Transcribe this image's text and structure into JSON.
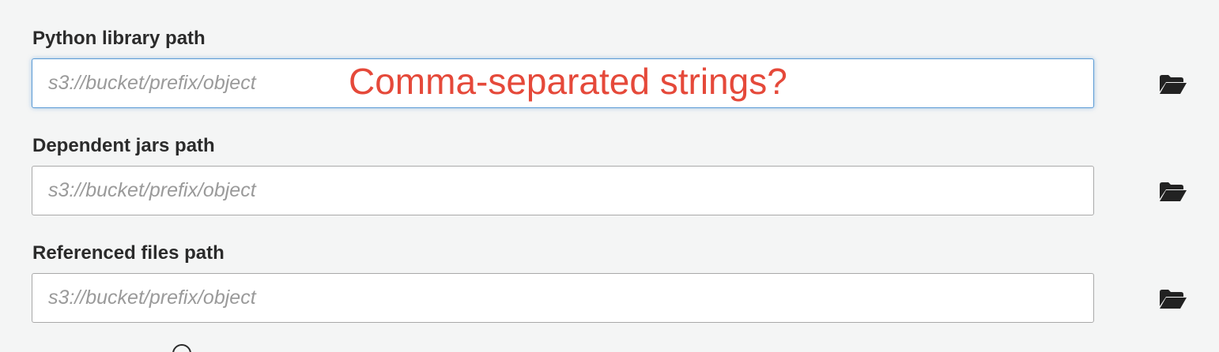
{
  "fields": [
    {
      "label": "Python library path",
      "placeholder": "s3://bucket/prefix/object",
      "value": "",
      "focused": true,
      "browse_icon": "folder-open-icon"
    },
    {
      "label": "Dependent jars path",
      "placeholder": "s3://bucket/prefix/object",
      "value": "",
      "focused": false,
      "browse_icon": "folder-open-icon"
    },
    {
      "label": "Referenced files path",
      "placeholder": "s3://bucket/prefix/object",
      "value": "",
      "focused": false,
      "browse_icon": "folder-open-icon"
    }
  ],
  "annotation": {
    "text": "Comma-separated strings?",
    "color": "#e5493a"
  },
  "colors": {
    "background": "#f4f5f5",
    "focus_border": "#5b9bd5",
    "label": "#2b2b2b"
  }
}
